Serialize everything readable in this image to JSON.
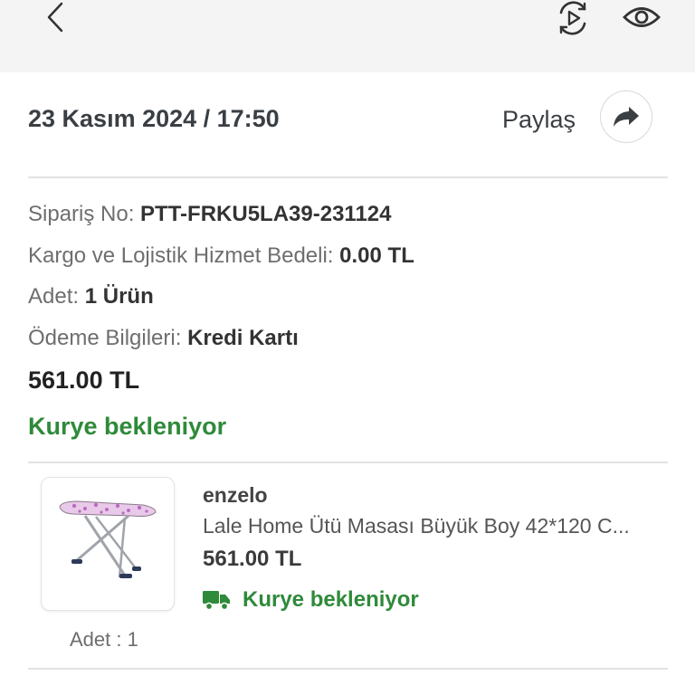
{
  "header": {
    "back_icon": "chevron-left-icon",
    "video_icon": "play-refresh-icon",
    "view_icon": "eye-icon"
  },
  "order": {
    "date_time": "23 Kasım 2024 / 17:50",
    "share_label": "Paylaş",
    "share_icon": "share-arrow-icon",
    "order_no_label": "Sipariş No:",
    "order_no_value": "PTT-FRKU5LA39-231124",
    "shipping_label": "Kargo ve Lojistik Hizmet Bedeli:",
    "shipping_value": "0.00 TL",
    "quantity_label": "Adet:",
    "quantity_value": "1 Ürün",
    "payment_label": "Ödeme Bilgileri:",
    "payment_value": "Kredi Kartı",
    "total": "561.00 TL",
    "status": "Kurye bekleniyor"
  },
  "item": {
    "seller": "enzelo",
    "name": "Lale Home Ütü Masası Büyük Boy 42*120 C...",
    "price": "561.00 TL",
    "status": "Kurye bekleniyor",
    "status_icon": "truck-icon",
    "quantity": "Adet : 1",
    "image": "ironing-board-image"
  },
  "colors": {
    "status_green": "#2f8a3a",
    "topbar_bg": "#f4f4f4"
  }
}
